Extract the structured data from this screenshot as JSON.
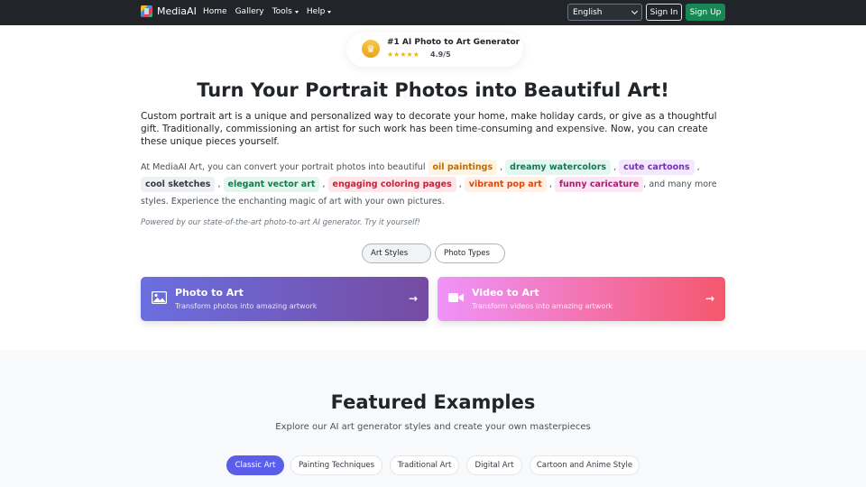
{
  "navbar": {
    "brand": "MediaAI",
    "links": [
      {
        "label": "Home",
        "dropdown": false
      },
      {
        "label": "Gallery",
        "dropdown": false
      },
      {
        "label": "Tools",
        "dropdown": true
      },
      {
        "label": "Help",
        "dropdown": true
      }
    ],
    "language": "English",
    "signin": "Sign In",
    "signup": "Sign Up"
  },
  "badge": {
    "title": "#1 AI Photo to Art Generator",
    "stars": "★★★★★",
    "rating": "4.9/5"
  },
  "hero": {
    "title": "Turn Your Portrait Photos into Beautiful Art!",
    "intro": "Custom portrait art is a unique and personalized way to decorate your home, make holiday cards, or give as a thoughtful gift. Traditionally, commissioning an artist for such work has been time-consuming and expensive. Now, you can create these unique pieces yourself.",
    "styles_prefix": "At MediaAI Art, you can convert your portrait photos into beautiful",
    "styles": [
      "oil paintings",
      "dreamy watercolors",
      "cute cartoons",
      "cool sketches",
      "elegant vector art",
      "engaging coloring pages",
      "vibrant pop art",
      "funny caricature"
    ],
    "styles_suffix": ", and many more styles. Experience the enchanting magic of art with your own pictures.",
    "powered": "Powered by our state-of-the-art photo-to-art AI generator. Try it yourself!"
  },
  "type_pills": [
    "Art Styles",
    "Photo Types"
  ],
  "cards": [
    {
      "title": "Photo to Art",
      "subtitle": "Transform photos into amazing artwork",
      "icon": "image-icon"
    },
    {
      "title": "Video to Art",
      "subtitle": "Transform videos into amazing artwork",
      "icon": "video-icon"
    }
  ],
  "featured": {
    "title": "Featured Examples",
    "subtitle": "Explore our AI art generator styles and create your own masterpieces",
    "tabs": [
      "Classic Art",
      "Painting Techniques",
      "Traditional Art",
      "Digital Art",
      "Cartoon and Anime Style"
    ],
    "active_tab": "Classic Art"
  },
  "colors": {
    "navbar": "#212529",
    "signup": "#198754",
    "accent": "#5b5ee8"
  }
}
